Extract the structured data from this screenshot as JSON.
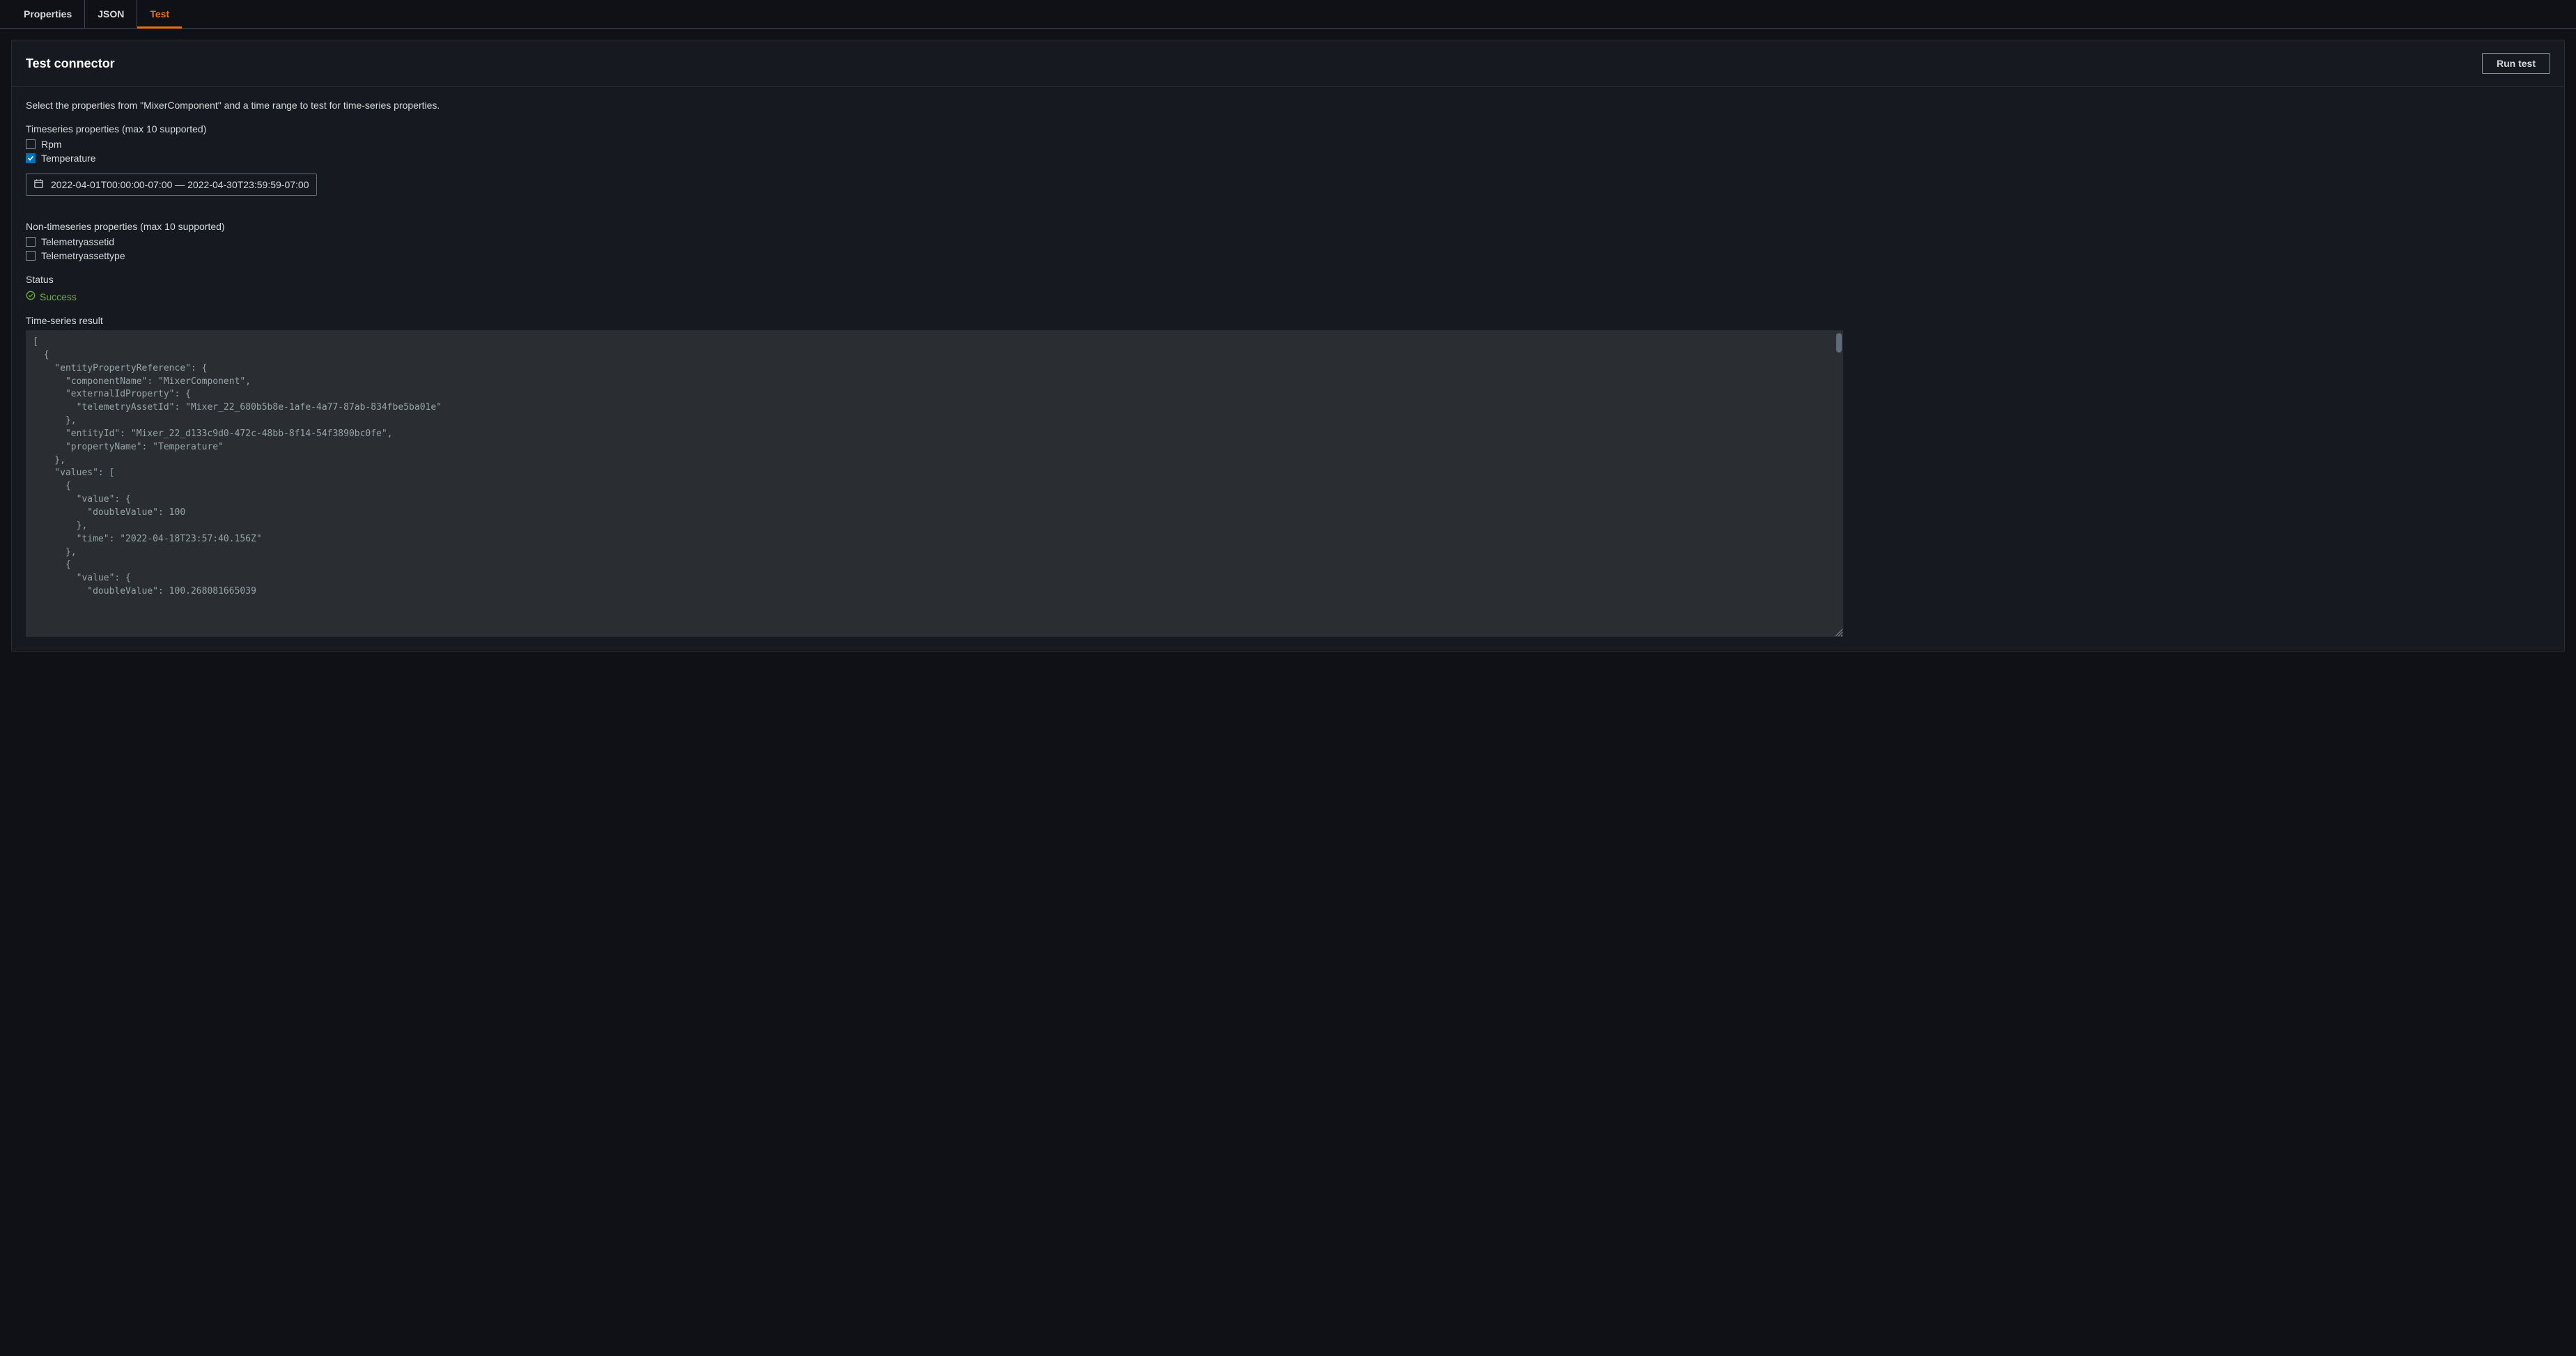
{
  "tabs": {
    "properties": "Properties",
    "json": "JSON",
    "test": "Test"
  },
  "panel": {
    "title": "Test connector",
    "runBtn": "Run test",
    "description": "Select the properties from \"MixerComponent\" and a time range to test for time-series properties."
  },
  "timeseries": {
    "label": "Timeseries properties (max 10 supported)",
    "rpm": "Rpm",
    "temperature": "Temperature"
  },
  "dateRange": "2022-04-01T00:00:00-07:00 — 2022-04-30T23:59:59-07:00",
  "nonTimeseries": {
    "label": "Non-timeseries properties (max 10 supported)",
    "assetId": "Telemetryassetid",
    "assetType": "Telemetryassettype"
  },
  "status": {
    "label": "Status",
    "value": "Success"
  },
  "result": {
    "label": "Time-series result",
    "content": "[\n  {\n    \"entityPropertyReference\": {\n      \"componentName\": \"MixerComponent\",\n      \"externalIdProperty\": {\n        \"telemetryAssetId\": \"Mixer_22_680b5b8e-1afe-4a77-87ab-834fbe5ba01e\"\n      },\n      \"entityId\": \"Mixer_22_d133c9d0-472c-48bb-8f14-54f3890bc0fe\",\n      \"propertyName\": \"Temperature\"\n    },\n    \"values\": [\n      {\n        \"value\": {\n          \"doubleValue\": 100\n        },\n        \"time\": \"2022-04-18T23:57:40.156Z\"\n      },\n      {\n        \"value\": {\n          \"doubleValue\": 100.268081665039"
  }
}
